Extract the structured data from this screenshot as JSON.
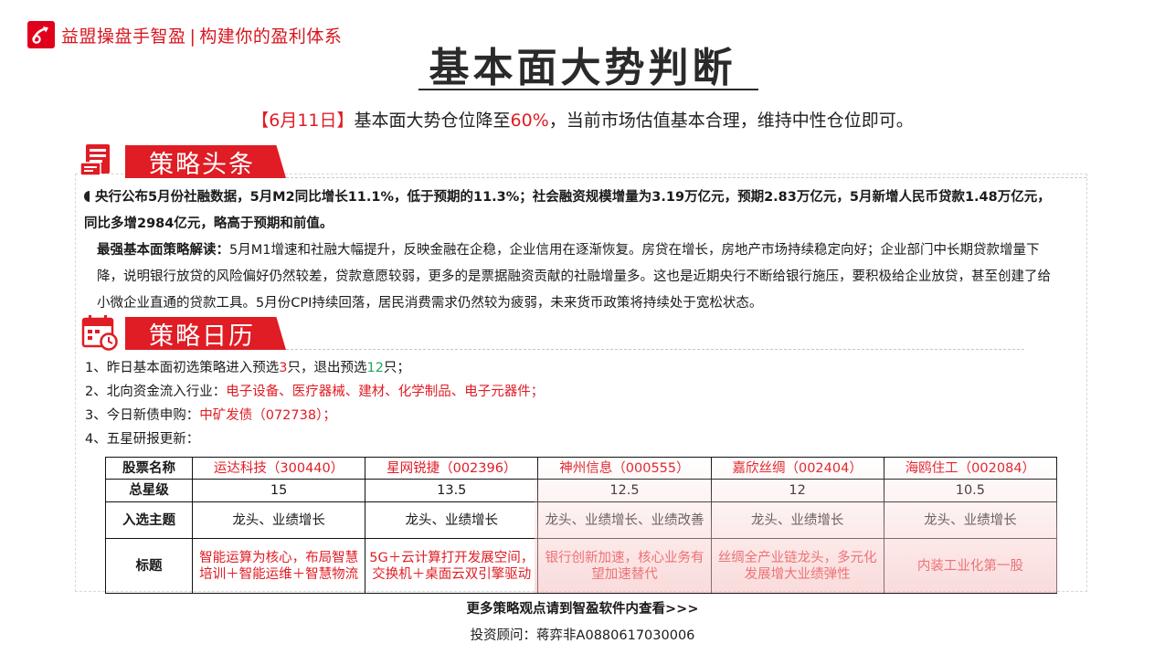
{
  "brand": {
    "name": "益盟操盘手智盈",
    "separator": "|",
    "slogan": "构建你的盈利体系"
  },
  "title": "基本面大势判断",
  "headline": {
    "date": "【6月11日】",
    "text_before": "基本面大势仓位降至",
    "position": "60%",
    "text_after": "，当前市场估值基本合理，维持中性仓位即可。"
  },
  "section_news": {
    "title": "策略头条",
    "icon": "news-document-icon",
    "lead": "央行公布5月份社融数据，5月M2同比增长11.1%，低于预期的11.3%；社会融资规模增量为3.19万亿元，预期2.83万亿元，5月新增人民币贷款1.48万亿元，同比多增2984亿元，略高于预期和前值。",
    "analysis_label": "最强基本面策略解读：",
    "analysis_text": "5月M1增速和社融大幅提升，反映金融在企稳，企业信用在逐渐恢复。房贷在增长，房地产市场持续稳定向好；企业部门中长期贷款增量下降，说明银行放贷的风险偏好仍然较差，贷款意愿较弱，更多的是票据融资贡献的社融增量多。这也是近期央行不断给银行施压，要积极给企业放贷，甚至创建了给小微企业直通的贷款工具。5月份CPI持续回落，居民消费需求仍然较为疲弱，未来货币政策将持续处于宽松状态。"
  },
  "section_calendar": {
    "title": "策略日历",
    "icon": "calendar-clock-icon",
    "item1": {
      "prefix": "1、昨日基本面初选策略进入预选",
      "enter": "3",
      "mid": "只，退出预选",
      "exit": "12",
      "suffix": "只；"
    },
    "item2": {
      "prefix": "2、北向资金流入行业：",
      "value": "电子设备、医疗器械、建材、化学制品、电子元器件；"
    },
    "item3": {
      "prefix": "3、今日新债申购：",
      "value": "中矿发债（072738）；"
    },
    "item4": {
      "prefix": "4、五星研报更新："
    }
  },
  "table": {
    "row_headers": [
      "股票名称",
      "总星级",
      "入选主题",
      "标题"
    ],
    "stocks": [
      {
        "name": "运达科技（300440）",
        "stars": "15",
        "theme": "龙头、业绩增长",
        "headline": "智能运算为核心，布局智慧培训＋智能运维＋智慧物流"
      },
      {
        "name": "星网锐捷（002396）",
        "stars": "13.5",
        "theme": "龙头、业绩增长",
        "headline": "5G＋云计算打开发展空间，交换机＋桌面云双引擎驱动"
      },
      {
        "name": "神州信息（000555）",
        "stars": "12.5",
        "theme": "龙头、业绩增长、业绩改善",
        "headline": "银行创新加速，核心业务有望加速替代"
      },
      {
        "name": "嘉欣丝绸（002404）",
        "stars": "12",
        "theme": "龙头、业绩增长",
        "headline": "丝绸全产业链龙头，多元化发展增大业绩弹性"
      },
      {
        "name": "海鸥住工（002084）",
        "stars": "10.5",
        "theme": "龙头、业绩增长",
        "headline": "内装工业化第一股"
      }
    ]
  },
  "footer": {
    "more": "更多策略观点请到智盈软件内查看>>>",
    "advisor": "投资顾问：蒋弈非A0880617030006"
  },
  "colors": {
    "accent_red": "#e01c24",
    "green": "#21a55a",
    "text": "#1a1a1a"
  }
}
